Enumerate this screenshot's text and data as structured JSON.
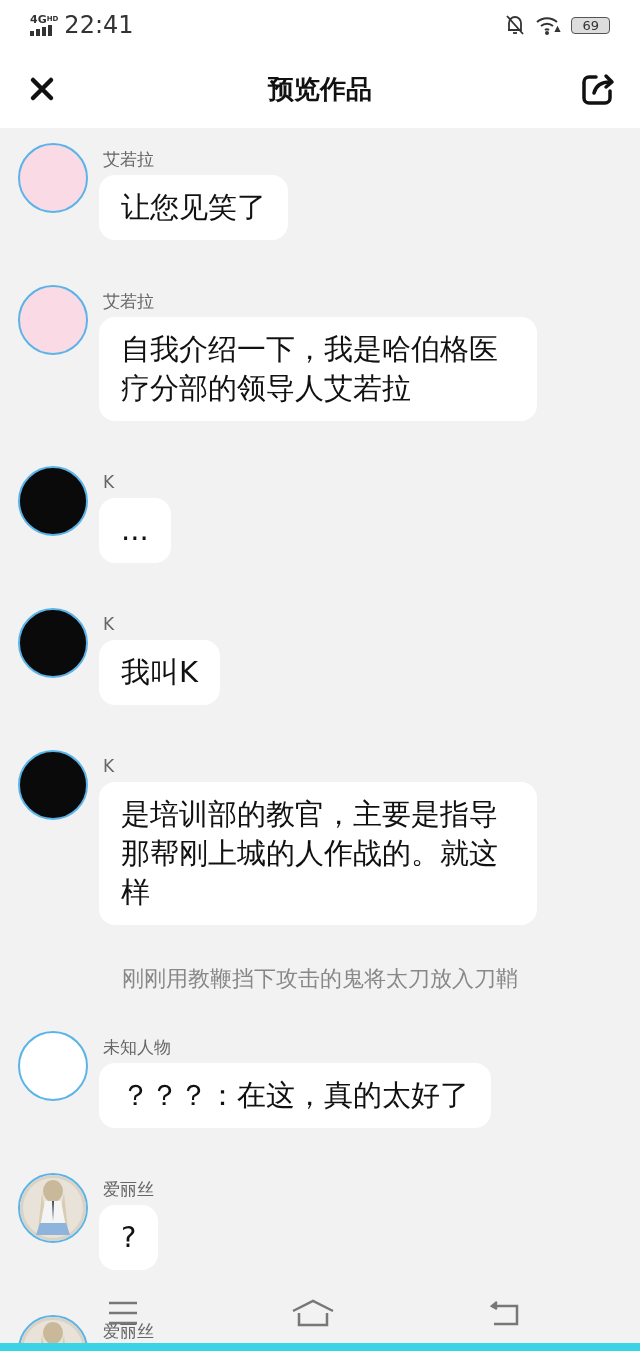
{
  "status_bar": {
    "network": "4G",
    "network_sub": "HD",
    "time": "22:41",
    "battery": "69"
  },
  "header": {
    "title": "预览作品"
  },
  "messages": [
    {
      "kind": "message",
      "name": "艾若拉",
      "avatar": {
        "kind": "color",
        "color": "#fadbe5"
      },
      "text": "让您见笑了"
    },
    {
      "kind": "message",
      "name": "艾若拉",
      "avatar": {
        "kind": "color",
        "color": "#fadbe5"
      },
      "text": "自我介绍一下，我是哈伯格医疗分部的领导人艾若拉"
    },
    {
      "kind": "message",
      "name": "K",
      "avatar": {
        "kind": "color",
        "color": "#0a0a0a"
      },
      "text": "..."
    },
    {
      "kind": "message",
      "name": "K",
      "avatar": {
        "kind": "color",
        "color": "#0a0a0a"
      },
      "text": "我叫K"
    },
    {
      "kind": "message",
      "name": "K",
      "avatar": {
        "kind": "color",
        "color": "#0a0a0a"
      },
      "text": "是培训部的教官，主要是指导那帮刚上城的人作战的。就这样"
    },
    {
      "kind": "narration",
      "text": "刚刚用教鞭挡下攻击的鬼将太刀放入刀鞘"
    },
    {
      "kind": "message",
      "name": "未知人物",
      "avatar": {
        "kind": "color",
        "color": "#ffffff"
      },
      "text": "？？？：在这，真的太好了"
    },
    {
      "kind": "message",
      "name": "爱丽丝",
      "text": "?"
    },
    {
      "kind": "message",
      "name": "爱丽丝"
    }
  ]
}
